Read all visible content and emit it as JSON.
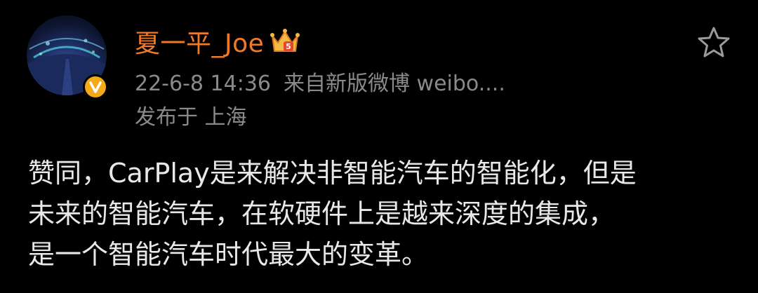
{
  "user": {
    "name": "夏一平_Joe",
    "badge_color": "#f4a916",
    "name_color": "#f07a2a"
  },
  "meta": {
    "time": "22-6-8 14:36",
    "source": "来自新版微博 weibo....",
    "location": "发布于 上海"
  },
  "post": {
    "lines": [
      "赞同，CarPlay是来解决非智能汽车的智能化，但是",
      "未来的智能汽车，在软硬件上是越来深度的集成，",
      "是一个智能汽车时代最大的变革。"
    ]
  },
  "icons": {
    "verified": "verified-badge-icon",
    "crown": "crown-icon",
    "favorite": "star-icon"
  }
}
